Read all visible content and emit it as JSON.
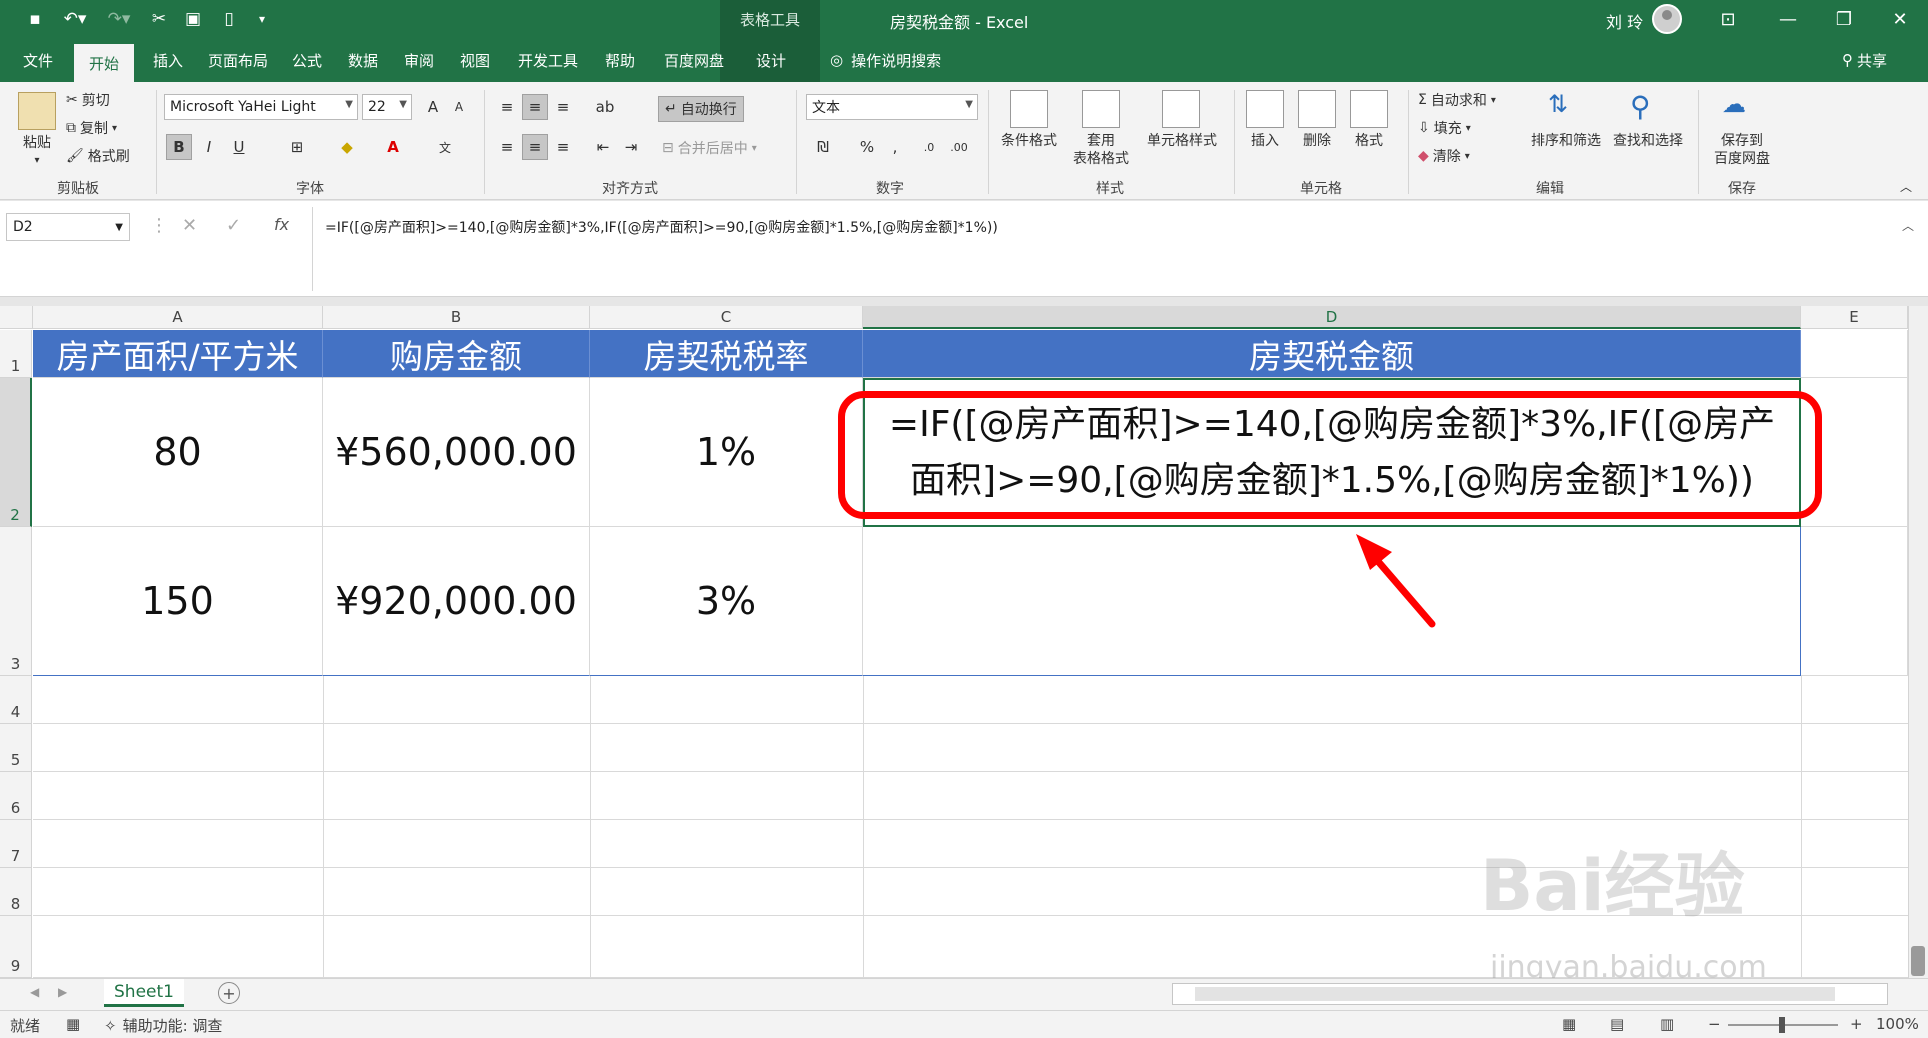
{
  "titlebar": {
    "context_tab_group": "表格工具",
    "document_title": "房契税金额  -  Excel",
    "user_name": "刘 玲",
    "quick_access": [
      "save-icon",
      "undo-icon",
      "redo-icon",
      "cut-icon",
      "save-as-icon",
      "new-icon",
      "customize-icon"
    ]
  },
  "tabs": [
    "文件",
    "开始",
    "插入",
    "页面布局",
    "公式",
    "数据",
    "审阅",
    "视图",
    "开发工具",
    "帮助",
    "百度网盘",
    "设计"
  ],
  "active_tab": "开始",
  "tell_me": "操作说明搜索",
  "share": "共享",
  "ribbon": {
    "clipboard": {
      "label": "剪贴板",
      "paste": "粘贴",
      "cut": "剪切",
      "copy": "复制",
      "format_painter": "格式刷"
    },
    "font": {
      "label": "字体",
      "font_name": "Microsoft YaHei Light",
      "font_size": "22",
      "bold": "B",
      "italic": "I",
      "underline": "U",
      "grow": "A",
      "shrink": "A"
    },
    "alignment": {
      "label": "对齐方式",
      "wrap_text": "自动换行",
      "merge_center": "合并后居中"
    },
    "number": {
      "label": "数字",
      "format": "文本",
      "percent": "%",
      "comma": ","
    },
    "styles": {
      "label": "样式",
      "conditional": "条件格式",
      "table_format_1": "套用",
      "table_format_2": "表格格式",
      "cell_styles": "单元格样式"
    },
    "cells": {
      "label": "单元格",
      "insert": "插入",
      "delete": "删除",
      "format": "格式"
    },
    "editing": {
      "label": "编辑",
      "autosum": "自动求和",
      "fill": "填充",
      "clear": "清除",
      "sort_filter": "排序和筛选",
      "find_select": "查找和选择"
    },
    "save": {
      "label": "保存",
      "save_baidu_1": "保存到",
      "save_baidu_2": "百度网盘"
    }
  },
  "formula_bar": {
    "name_box": "D2",
    "fx": "fx",
    "formula": "=IF([@房产面积]>=140,[@购房金额]*3%,IF([@房产面积]>=90,[@购房金额]*1.5%,[@购房金额]*1%))"
  },
  "columns": [
    "A",
    "B",
    "C",
    "D",
    "E"
  ],
  "rows": [
    "1",
    "2",
    "3",
    "4",
    "5",
    "6",
    "7",
    "8",
    "9"
  ],
  "table": {
    "headers": [
      "房产面积/平方米",
      "购房金额",
      "房契税税率",
      "房契税金额"
    ],
    "rows": [
      [
        "80",
        "¥560,000.00",
        "1%",
        "=IF([@房产面积]>=140,[@购房金额]*3%,IF([@房产面积]>=90,[@购房金额]*1.5%,[@购房金额]*1%))"
      ],
      [
        "150",
        "¥920,000.00",
        "3%",
        ""
      ]
    ]
  },
  "sheet_tabs": [
    "Sheet1"
  ],
  "statusbar": {
    "mode": "就绪",
    "accessibility": "辅助功能: 调查",
    "zoom": "100%"
  },
  "watermark": {
    "brand": "Bai经验",
    "url": "jingyan.baidu.com"
  },
  "colors": {
    "excel_green": "#217346",
    "table_header": "#4472c4",
    "highlight_red": "#ff0000"
  }
}
